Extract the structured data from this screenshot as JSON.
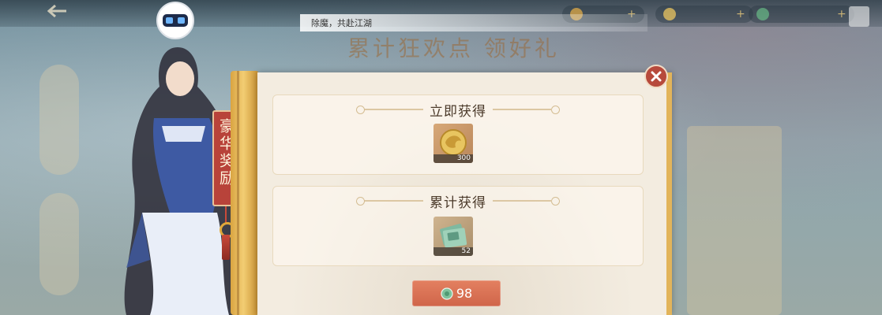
{
  "marquee": {
    "text": "除魔，共赴江湖"
  },
  "tag": {
    "text": "豪华奖励"
  },
  "sections": [
    {
      "title": "立即获得",
      "item": {
        "icon": "gold-dragon-coin-icon",
        "quantity": "300"
      }
    },
    {
      "title": "累计获得",
      "item": {
        "icon": "jade-banknote-icon",
        "quantity": "52"
      }
    }
  ],
  "buy_button": {
    "price": "98",
    "icon": "jade-currency-icon"
  },
  "colors": {
    "accent": "#d0654a",
    "panel": "#f3ece0",
    "gold": "#e2b45a",
    "tag_red": "#b8433a"
  }
}
